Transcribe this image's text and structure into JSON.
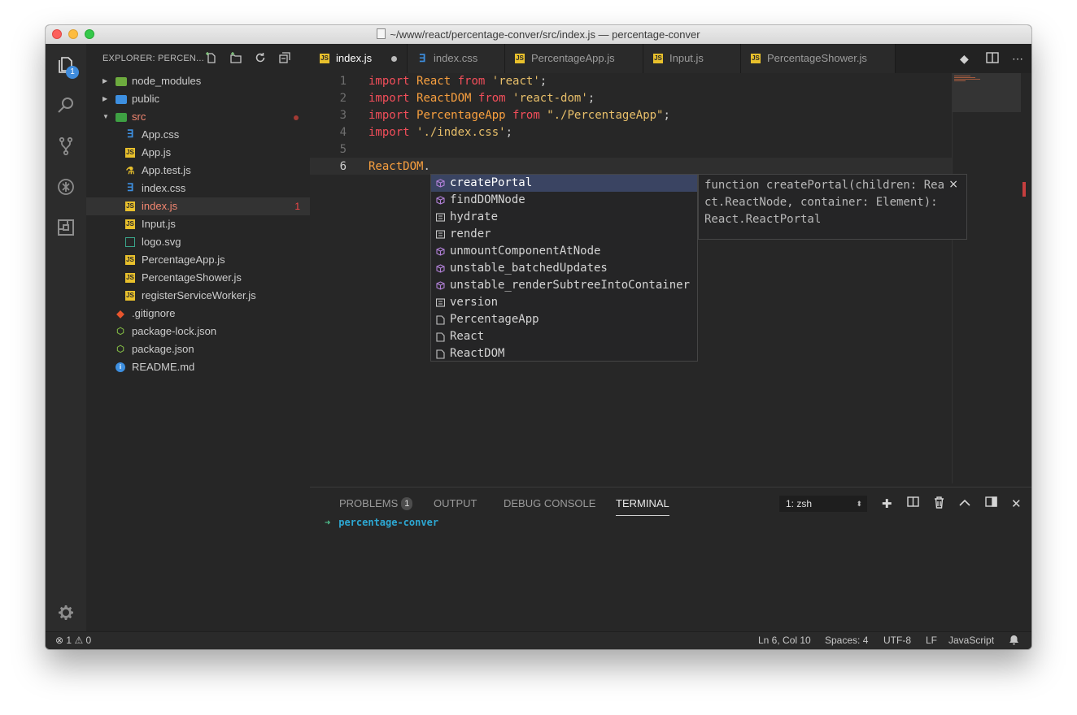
{
  "window": {
    "title": "~/www/react/percentage-conver/src/index.js — percentage-conver"
  },
  "activity_bar": {
    "explorer_badge": "1"
  },
  "sidebar": {
    "header": "EXPLORER: PERCEN...",
    "items": [
      {
        "label": "node_modules",
        "type": "folder"
      },
      {
        "label": "public",
        "type": "folder"
      },
      {
        "label": "src",
        "type": "folder-open"
      },
      {
        "label": "App.css",
        "type": "css"
      },
      {
        "label": "App.js",
        "type": "js"
      },
      {
        "label": "App.test.js",
        "type": "test"
      },
      {
        "label": "index.css",
        "type": "css"
      },
      {
        "label": "index.js",
        "type": "js",
        "count": "1"
      },
      {
        "label": "Input.js",
        "type": "js"
      },
      {
        "label": "logo.svg",
        "type": "svg"
      },
      {
        "label": "PercentageApp.js",
        "type": "js"
      },
      {
        "label": "PercentageShower.js",
        "type": "js"
      },
      {
        "label": "registerServiceWorker.js",
        "type": "js"
      },
      {
        "label": ".gitignore",
        "type": "git"
      },
      {
        "label": "package-lock.json",
        "type": "npm"
      },
      {
        "label": "package.json",
        "type": "npm"
      },
      {
        "label": "README.md",
        "type": "info"
      }
    ]
  },
  "tabs": [
    {
      "label": "index.js",
      "icon": "JS",
      "active": true,
      "modified": true
    },
    {
      "label": "index.css",
      "icon": "css"
    },
    {
      "label": "PercentageApp.js",
      "icon": "JS"
    },
    {
      "label": "Input.js",
      "icon": "JS"
    },
    {
      "label": "PercentageShower.js",
      "icon": "JS"
    }
  ],
  "code": {
    "line_numbers": [
      "1",
      "2",
      "3",
      "4",
      "5",
      "6"
    ],
    "lines": [
      {
        "kw": "import",
        "id": "React",
        "from": "from",
        "str": "'react'",
        "end": ";"
      },
      {
        "kw": "import",
        "id": "ReactDOM",
        "from": "from",
        "str": "'react-dom'",
        "end": ";"
      },
      {
        "kw": "import",
        "id": "PercentageApp",
        "from": "from",
        "str": "\"./PercentageApp\"",
        "end": ";"
      },
      {
        "kw": "import",
        "str": "'./index.css'",
        "end": ";"
      },
      {},
      {
        "id": "ReactDOM",
        "end": "."
      }
    ]
  },
  "suggestions": [
    {
      "label": "createPortal",
      "kind": "method"
    },
    {
      "label": "findDOMNode",
      "kind": "method"
    },
    {
      "label": "hydrate",
      "kind": "field"
    },
    {
      "label": "render",
      "kind": "field"
    },
    {
      "label": "unmountComponentAtNode",
      "kind": "method"
    },
    {
      "label": "unstable_batchedUpdates",
      "kind": "method"
    },
    {
      "label": "unstable_renderSubtreeIntoContainer",
      "kind": "method"
    },
    {
      "label": "version",
      "kind": "field"
    },
    {
      "label": "PercentageApp",
      "kind": "file"
    },
    {
      "label": "React",
      "kind": "file"
    },
    {
      "label": "ReactDOM",
      "kind": "file"
    }
  ],
  "suggestion_detail": {
    "lines": [
      "function createPortal(children: Rea",
      "ct.ReactNode, container: Element):",
      "React.ReactPortal"
    ],
    "close": "×"
  },
  "panel": {
    "tabs": {
      "problems": "PROBLEMS",
      "problems_count": "1",
      "output": "OUTPUT",
      "debug": "DEBUG CONSOLE",
      "terminal": "TERMINAL"
    },
    "terminal_select": "1: zsh",
    "prompt_arrow": "➜",
    "prompt_dir": "percentage-conver"
  },
  "status": {
    "errors": "1",
    "warnings": "0",
    "position": "Ln 6, Col 10",
    "spaces": "Spaces: 4",
    "encoding": "UTF-8",
    "eol": "LF",
    "language": "JavaScript"
  },
  "colors": {
    "keyword": "#f24e5a",
    "identifier": "#f9a03f",
    "string": "#e8bf6a",
    "js_icon": "#e8c02c",
    "css_icon": "#3d8fe0",
    "selection": "#3a4462"
  }
}
